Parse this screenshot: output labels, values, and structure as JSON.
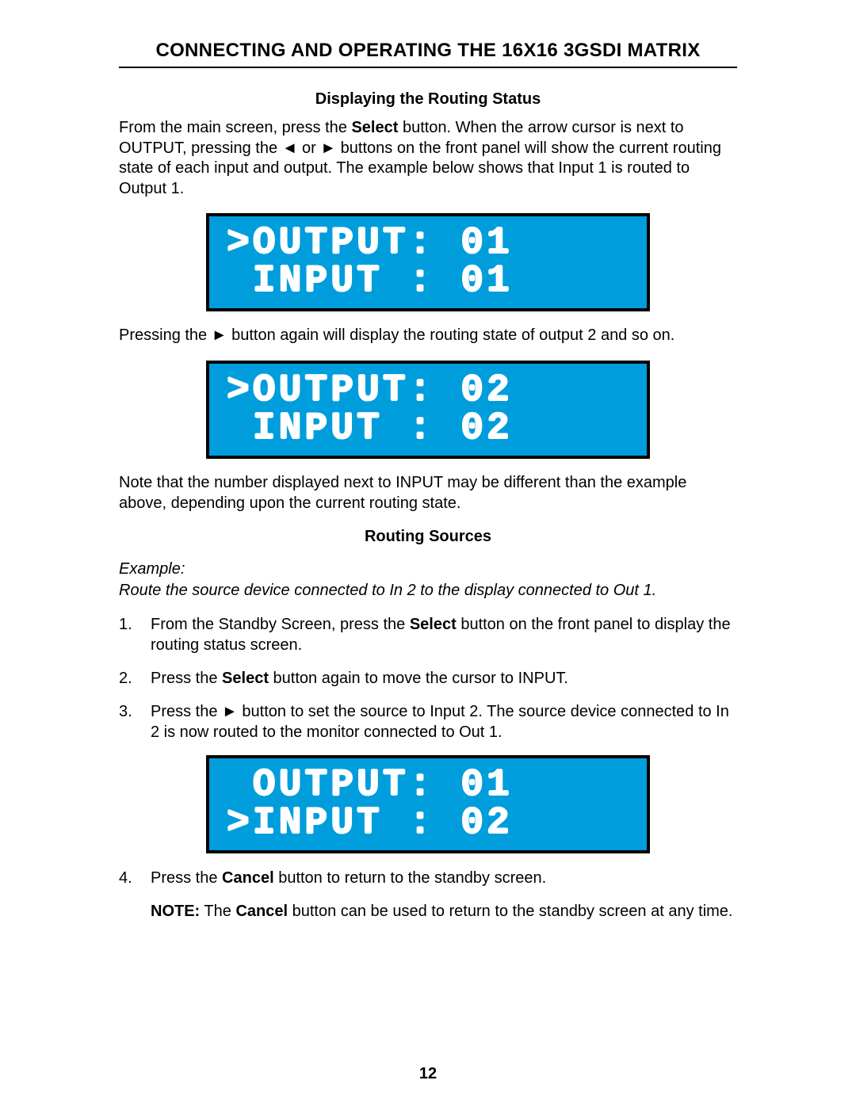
{
  "title": "CONNECTING AND OPERATING THE 16X16 3GSDI MATRIX",
  "section1": {
    "heading": "Displaying the Routing Status",
    "para1_a": "From the main screen, press the ",
    "para1_b_bold": "Select",
    "para1_c": " button.  When the arrow cursor is next to OUTPUT, pressing the ◄ or ► buttons on the front panel will show the current routing state of each input and output.  The example below shows that Input 1 is routed to Output 1."
  },
  "lcd1": {
    "line1": ">OUTPUT: 01",
    "line2": " INPUT : 01"
  },
  "para2": "Pressing the ► button again will display the routing state of output 2 and so on.",
  "lcd2": {
    "line1": ">OUTPUT: 02",
    "line2": " INPUT : 02"
  },
  "para3": "Note that the number displayed next to INPUT may be different than the example above, depending upon the current routing state.",
  "section2": {
    "heading": "Routing Sources",
    "example_label": "Example:",
    "example_desc": "Route the source device connected to In 2 to the display connected to Out 1."
  },
  "steps": {
    "s1": {
      "num": "1.",
      "a": "From the Standby Screen, press the ",
      "b_bold": "Select",
      "c": " button on the front panel to display the routing status screen."
    },
    "s2": {
      "num": "2.",
      "a": "Press the ",
      "b_bold": "Select",
      "c": " button again to move the cursor to INPUT."
    },
    "s3": {
      "num": "3.",
      "a": "Press the ► button to set the source to Input 2.  The source device connected to In 2 is now routed to the monitor connected to Out 1."
    },
    "s4": {
      "num": "4.",
      "a": "Press the ",
      "b_bold": "Cancel",
      "c": " button to return to the standby screen."
    }
  },
  "lcd3": {
    "line1": " OUTPUT: 01",
    "line2": ">INPUT : 02"
  },
  "note": {
    "label": "NOTE:",
    "a": " The ",
    "b_bold": "Cancel",
    "c": " button can be used to return to the standby screen at any time."
  },
  "pagenum": "12"
}
